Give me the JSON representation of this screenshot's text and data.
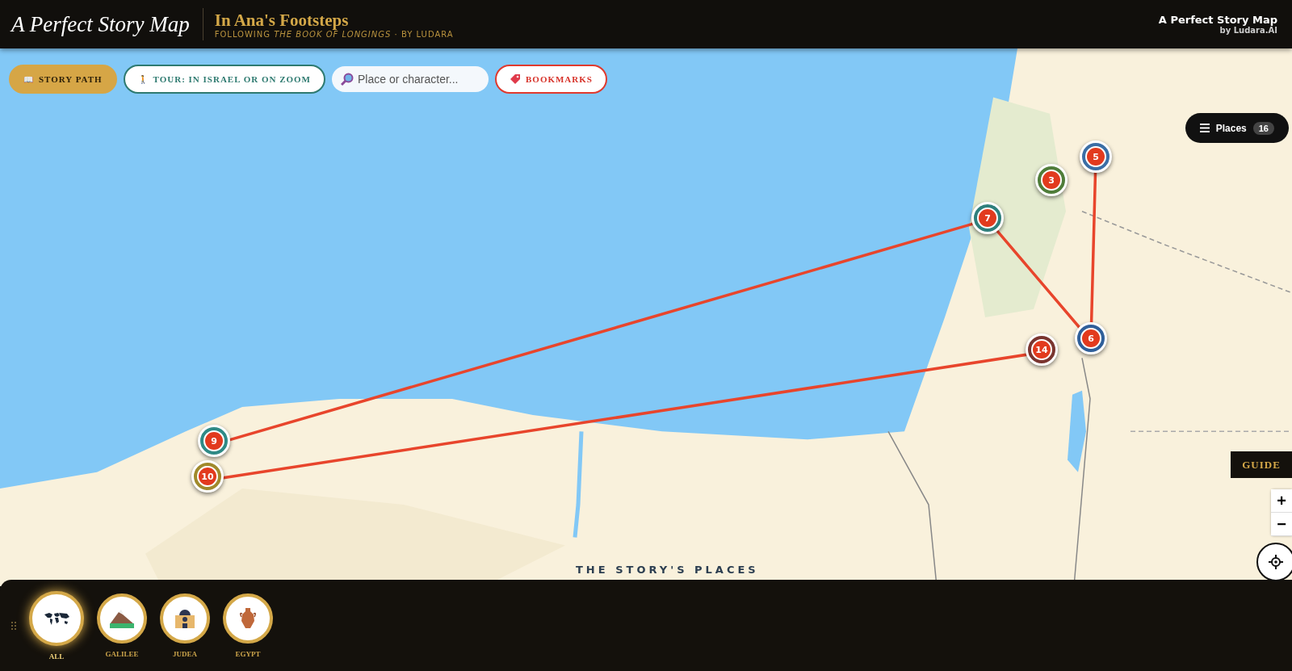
{
  "header": {
    "brand": "A Perfect Story Map",
    "title": "In Ana's Footsteps",
    "subtitle": "FOLLOWING *THE BOOK OF LONGINGS* · BY LUDARA",
    "credit_title": "A Perfect Story Map",
    "credit_by": "by Ludara.AI"
  },
  "toolbar": {
    "story_path_icon": "📖",
    "story_path": "STORY PATH",
    "tour_icon": "🚶",
    "tour": "TOUR: IN ISRAEL OR ON ZOOM",
    "search": {
      "placeholder": "Place or character..."
    },
    "bookmarks": "BOOKMARKS"
  },
  "places_button": {
    "label": "Places",
    "count": "16"
  },
  "guide_tab": "GUIDE",
  "zoom": {
    "in": "+",
    "out": "−"
  },
  "markers": [
    {
      "number": "3",
      "color": "#4f7d3a"
    },
    {
      "number": "5",
      "color": "#3b6ea5"
    },
    {
      "number": "7",
      "color": "#2f7f7c"
    },
    {
      "number": "14",
      "color": "#7a3530"
    },
    {
      "number": "6",
      "color": "#2f5f9a"
    },
    {
      "number": "9",
      "color": "#2f8a86"
    },
    {
      "number": "10",
      "color": "#a08a2c"
    }
  ],
  "map_caption": "THE STORY'S PLACES",
  "regions": [
    {
      "label": "ALL",
      "kind": "world",
      "selected": true
    },
    {
      "label": "GALILEE",
      "kind": "hill",
      "selected": false
    },
    {
      "label": "JUDEA",
      "kind": "temple",
      "selected": false
    },
    {
      "label": "EGYPT",
      "kind": "vase",
      "selected": false
    }
  ]
}
